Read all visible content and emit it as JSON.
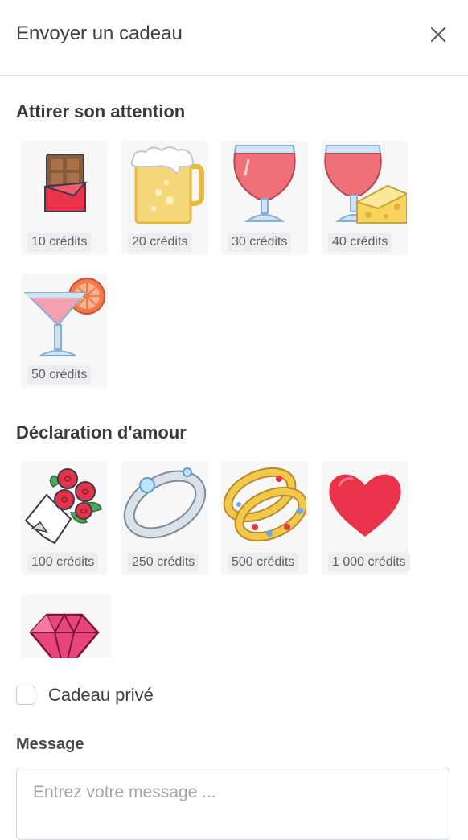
{
  "header": {
    "title": "Envoyer un cadeau",
    "close_icon": "close-icon"
  },
  "sections": [
    {
      "title": "Attirer son attention",
      "gifts": [
        {
          "icon": "chocolate-bar-icon",
          "price": "10 crédits"
        },
        {
          "icon": "beer-mug-icon",
          "price": "20 crédits"
        },
        {
          "icon": "wine-glass-icon",
          "price": "30 crédits"
        },
        {
          "icon": "wine-cheese-icon",
          "price": "40 crédits"
        },
        {
          "icon": "cocktail-icon",
          "price": "50 crédits"
        }
      ]
    },
    {
      "title": "Déclaration d'amour",
      "gifts": [
        {
          "icon": "rose-bouquet-icon",
          "price": "100 crédits"
        },
        {
          "icon": "silver-bracelet-icon",
          "price": "250 crédits"
        },
        {
          "icon": "gold-bangles-icon",
          "price": "500 crédits"
        },
        {
          "icon": "heart-icon",
          "price": "1 000 crédits"
        },
        {
          "icon": "ruby-gem-icon",
          "price": ""
        }
      ]
    }
  ],
  "private_gift": {
    "label": "Cadeau privé",
    "checked": false
  },
  "message": {
    "label": "Message",
    "placeholder": "Entrez votre message ...",
    "value": ""
  },
  "colors": {
    "accent_red": "#e8334a",
    "wine": "#f0707a",
    "gold": "#f2c84b",
    "divider": "#d8dde3"
  }
}
